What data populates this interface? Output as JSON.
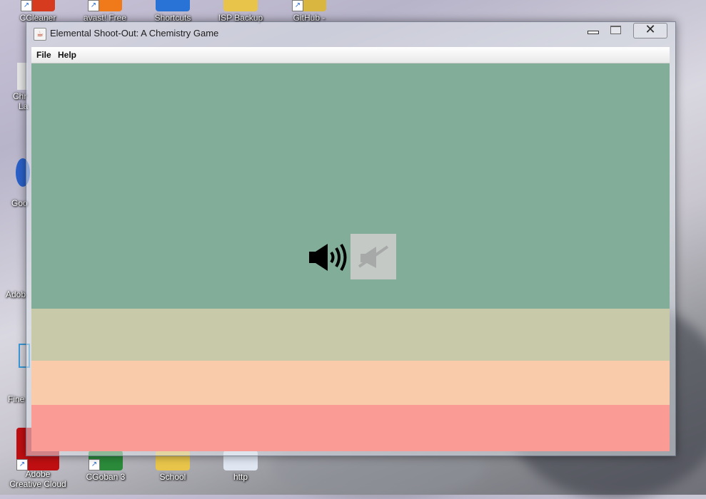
{
  "desktop": {
    "top_icons": [
      {
        "label": "CCleaner",
        "color": "#d63a1f"
      },
      {
        "label": "avast! Free",
        "color": "#f07a1a"
      },
      {
        "label": "Shortcuts",
        "color": "#2a73d6"
      },
      {
        "label": "ISP Backup",
        "color": "#e8c54a"
      },
      {
        "label": "GitHub -",
        "color": "#d8b640"
      }
    ],
    "edge_icons": [
      {
        "label": "Chr"
      },
      {
        "label": "La"
      },
      {
        "label": "Goo"
      },
      {
        "label": "Adob"
      },
      {
        "label": "Fine"
      }
    ],
    "bottom_icons": [
      {
        "label": "Adobe Creative Cloud",
        "color": "#c00f12"
      },
      {
        "label": "CGoban 3",
        "color": "#2a8a3a"
      },
      {
        "label": "School",
        "color": "#e8c54a"
      },
      {
        "label": "http",
        "color": "#dfe6f2"
      }
    ]
  },
  "window": {
    "title": "Elemental Shoot-Out: A Chemistry Game",
    "app_icon": "java-cup-icon",
    "controls": {
      "minimize": "minimize-icon",
      "maximize": "maximize-icon",
      "close_glyph": "✕"
    }
  },
  "menu": {
    "file": "File",
    "help": "Help"
  },
  "bands": [
    {
      "name": "band-teal",
      "color": "#82ae99"
    },
    {
      "name": "band-khaki",
      "color": "#c8c9a8"
    },
    {
      "name": "band-peach",
      "color": "#f9cbab"
    },
    {
      "name": "band-salmon",
      "color": "#fa9c95"
    }
  ],
  "sound": {
    "speaker_icon": "speaker-on-icon",
    "mute_icon": "speaker-muted-icon"
  }
}
